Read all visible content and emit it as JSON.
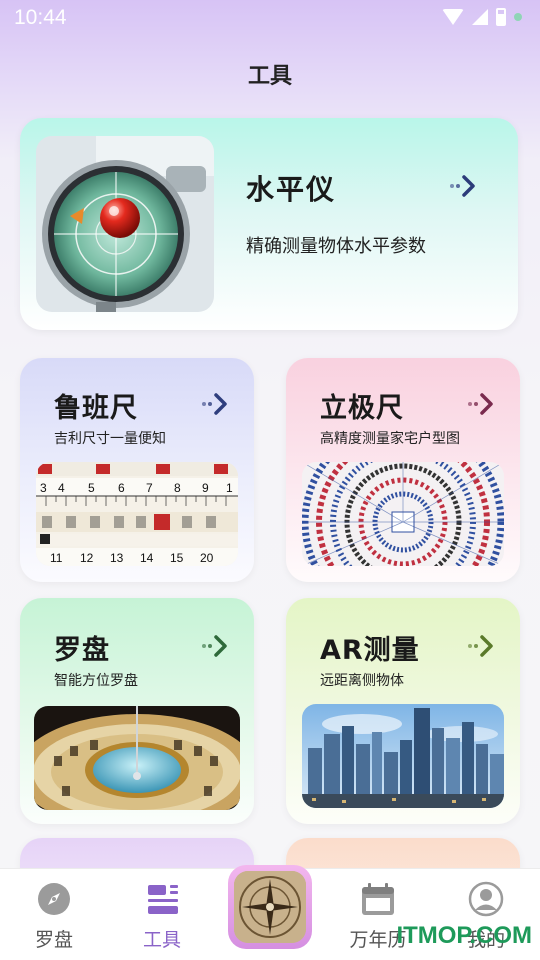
{
  "status_bar": {
    "time": "10:44"
  },
  "header": {
    "title": "工具"
  },
  "hero": {
    "title": "水平仪",
    "subtitle": "精确测量物体水平参数"
  },
  "cards": [
    {
      "title": "鲁班尺",
      "subtitle": "吉利尺寸一量便知",
      "bg_top": "#d9dcf8",
      "arrow_color": "#2f3e7e"
    },
    {
      "title": "立极尺",
      "subtitle": "高精度测量家宅户型图",
      "bg_top": "#f8d3e1",
      "arrow_color": "#7a2a4e"
    },
    {
      "title": "罗盘",
      "subtitle": "智能方位罗盘",
      "bg_top": "#c8f2d8",
      "arrow_color": "#2e6a3a"
    },
    {
      "title": "AR测量",
      "subtitle": "远距离侧物体",
      "bg_top": "#e6f6c7",
      "arrow_color": "#5a7a2a"
    }
  ],
  "bottom_nav": {
    "items": [
      {
        "label": "罗盘",
        "icon": "compass-icon",
        "active": false
      },
      {
        "label": "工具",
        "icon": "tools-icon",
        "active": true
      },
      {
        "label": "",
        "icon": "luopan-center-icon",
        "active": false
      },
      {
        "label": "万年历",
        "icon": "calendar-icon",
        "active": false
      },
      {
        "label": "我的",
        "icon": "user-icon",
        "active": false
      }
    ],
    "active_color": "#8a63c8"
  },
  "watermark": "ITMOP.COM"
}
